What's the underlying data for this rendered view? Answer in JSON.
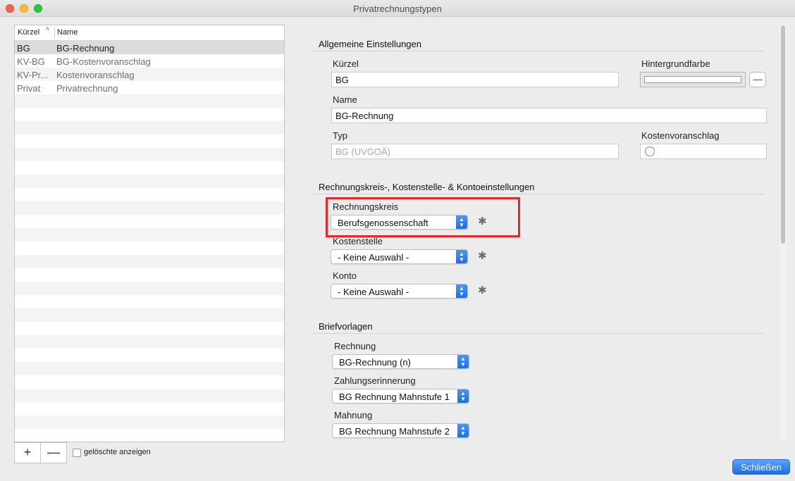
{
  "window": {
    "title": "Privatrechnungstypen"
  },
  "list": {
    "columns": {
      "kuerzel": "Kürzel",
      "name": "Name"
    },
    "sort_icon": "chevron-up-icon",
    "rows": [
      {
        "kuerzel": "BG",
        "name": "BG-Rechnung",
        "selected": true
      },
      {
        "kuerzel": "KV-BG",
        "name": "BG-Kostenvoranschlag",
        "selected": false
      },
      {
        "kuerzel": "KV-Pr...",
        "name": "Kostenvoranschlag",
        "selected": false
      },
      {
        "kuerzel": "Privat",
        "name": "Privatrechnung",
        "selected": false
      }
    ],
    "add_label": "+",
    "remove_label": "—",
    "show_deleted_label": "gelöschte anzeigen"
  },
  "general": {
    "title": "Allgemeine Einstellungen",
    "kuerzel_label": "Kürzel",
    "kuerzel_value": "BG",
    "bgcolor_label": "Hintergrundfarbe",
    "bgcolor_value": "#ffffff",
    "bgcolor_clear_label": "—",
    "name_label": "Name",
    "name_value": "BG-Rechnung",
    "typ_label": "Typ",
    "typ_value": "BG (UVGOÄ)",
    "kv_label": "Kostenvoranschlag"
  },
  "accounting": {
    "title": "Rechnungskreis-, Kostenstelle- & Kontoeinstellungen",
    "rechnungskreis_label": "Rechnungskreis",
    "rechnungskreis_value": "Berufsgenossenschaft",
    "kostenstelle_label": "Kostenstelle",
    "kostenstelle_value": "- Keine Auswahl -",
    "konto_label": "Konto",
    "konto_value": "- Keine Auswahl -"
  },
  "letters": {
    "title": "Briefvorlagen",
    "rechnung_label": "Rechnung",
    "rechnung_value": "BG-Rechnung (n)",
    "zahlung_label": "Zahlungserinnerung",
    "zahlung_value": "BG Rechnung Mahnstufe 1",
    "mahnung_label": "Mahnung",
    "mahnung_value": "BG Rechnung Mahnstufe 2"
  },
  "footer": {
    "close_label": "Schließen"
  },
  "colors": {
    "accent": "#1c6de6",
    "highlight": "#e8262b"
  }
}
